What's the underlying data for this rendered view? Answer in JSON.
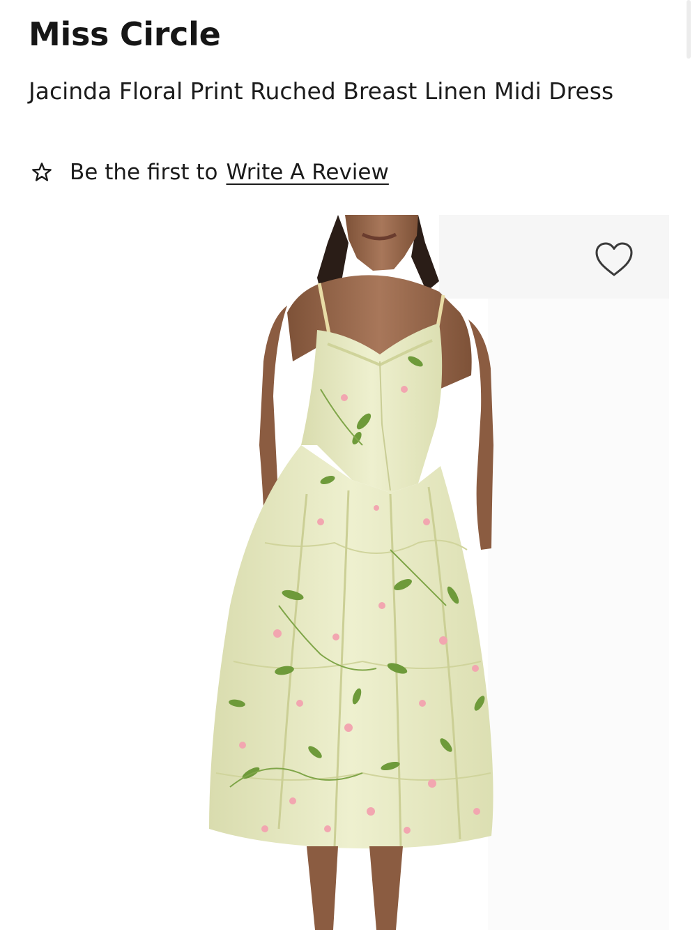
{
  "product": {
    "brand": "Miss Circle",
    "title": "Jacinda Floral Print Ruched Breast Linen Midi Dress"
  },
  "reviews": {
    "lead_text": "Be the first to",
    "link_label": "Write A Review",
    "icon": "star-outline-icon"
  },
  "media": {
    "wishlist_icon": "heart-outline-icon",
    "image_subject": "floral-midi-dress-photo"
  },
  "colors": {
    "text": "#1a1a1a",
    "dress_base": "#eef0cf",
    "dress_leaf": "#6e9a3a",
    "dress_flower": "#f2a6b0",
    "skin": "#9a6a4c"
  }
}
